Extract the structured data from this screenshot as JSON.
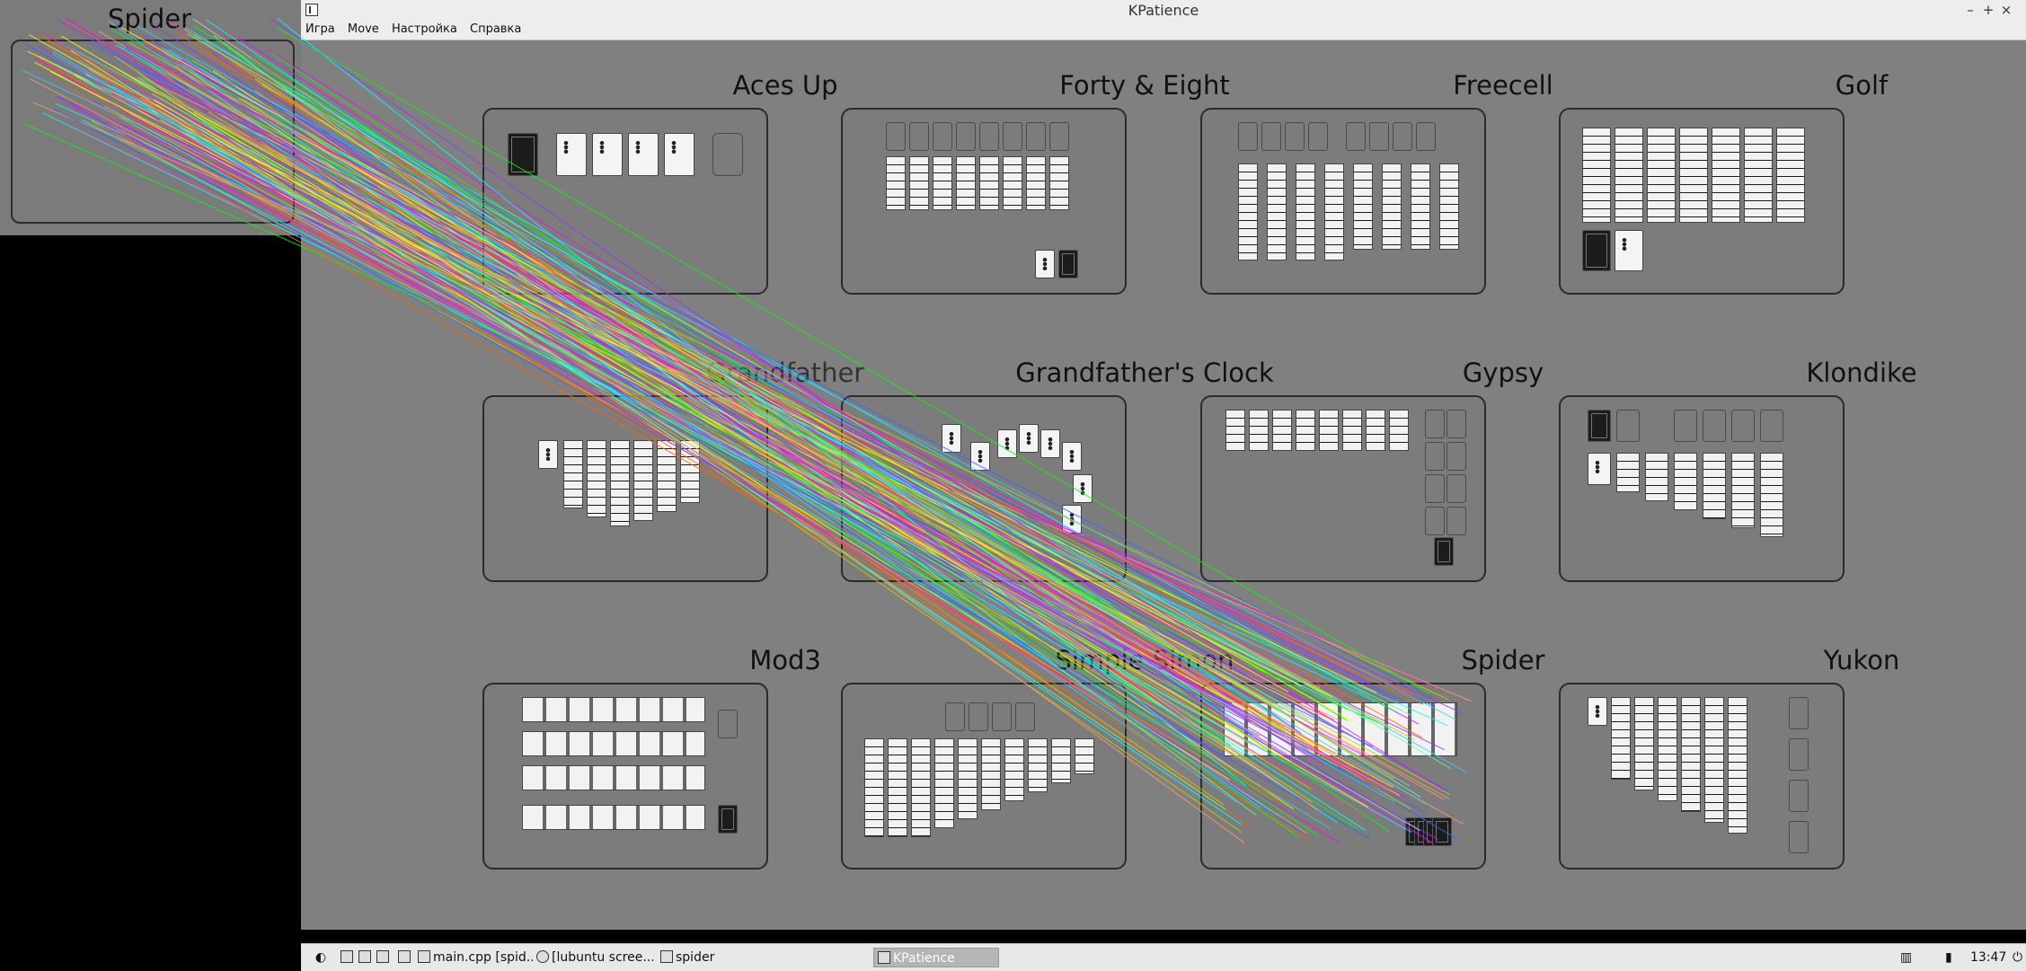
{
  "window": {
    "title": "KPatience"
  },
  "menubar": {
    "items": [
      "Игра",
      "Move",
      "Настройка",
      "Справка"
    ]
  },
  "games": {
    "aces_up": "Aces Up",
    "forty_eight": "Forty & Eight",
    "freecell": "Freecell",
    "golf": "Golf",
    "grandfather": "Grandfather",
    "grandfathers_clock": "Grandfather's Clock",
    "gypsy": "Gypsy",
    "klondike": "Klondike",
    "mod3": "Mod3",
    "simple_simon": "Simple Simon",
    "spider": "Spider",
    "yukon": "Yukon"
  },
  "overlay": {
    "title": "Spider"
  },
  "taskbar": {
    "items": [
      {
        "label": "main.cpp [spid...",
        "icon": "document-icon"
      },
      {
        "label": "[lubuntu scree...",
        "icon": "circle-icon"
      },
      {
        "label": "spider",
        "icon": "application-icon"
      },
      {
        "label": "KPatience",
        "icon": "cards-icon",
        "active": true
      }
    ],
    "clock": "13:47"
  },
  "colors": {
    "background": "#808080",
    "window_chrome": "#ededed",
    "taskbar": "#e8e8e8"
  }
}
